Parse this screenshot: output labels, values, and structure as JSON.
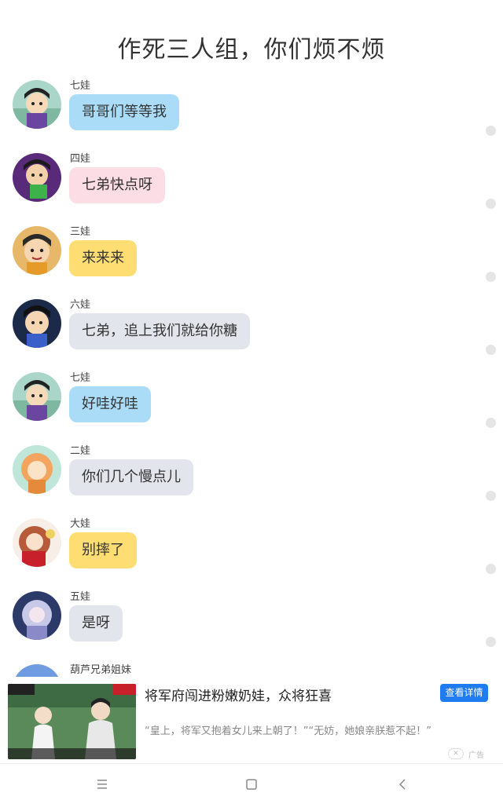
{
  "title": "作死三人组，你们烦不烦",
  "messages": [
    {
      "sender": "七娃",
      "text": "哥哥们等等我",
      "avatar": "qiwa-avatar"
    },
    {
      "sender": "四娃",
      "text": "七弟快点呀",
      "avatar": "siwa-avatar"
    },
    {
      "sender": "三娃",
      "text": "来来来",
      "avatar": "sanwa-avatar"
    },
    {
      "sender": "六娃",
      "text": "七弟，追上我们就给你糖",
      "avatar": "liuwa-avatar"
    },
    {
      "sender": "七娃",
      "text": "好哇好哇",
      "avatar": "qiwa-avatar"
    },
    {
      "sender": "二娃",
      "text": "你们几个慢点儿",
      "avatar": "erwa-avatar"
    },
    {
      "sender": "大娃",
      "text": "别摔了",
      "avatar": "dawa-avatar"
    },
    {
      "sender": "五娃",
      "text": "是呀",
      "avatar": "wuwa-avatar"
    },
    {
      "sender": "葫芦兄弟姐妹",
      "avatar": "group-avatar"
    }
  ],
  "ad": {
    "title": "将军府闯进粉嫩奶娃，众将狂喜",
    "button": "查看详情",
    "description": "“皇上，将军又抱着女儿来上朝了！”“无妨，她娘亲朕惹不起！”",
    "close_icon": "close-icon",
    "label": "广告"
  },
  "navbar": {
    "menu_icon": "menu-icon",
    "home_icon": "home-square-icon",
    "back_icon": "back-chevron-icon"
  },
  "colors": {
    "blue_bubble": "#aadcf8",
    "pink_bubble": "#fcdde5",
    "yellow_bubble": "#fedd73",
    "grey_bubble": "#e2e6ec",
    "ad_button": "#1f7cf0"
  }
}
